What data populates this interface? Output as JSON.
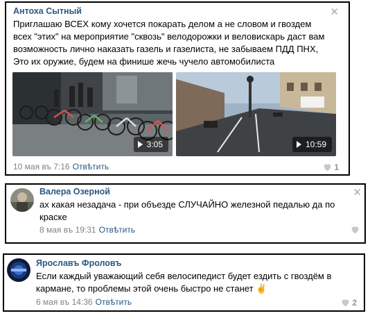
{
  "comments": [
    {
      "author": "Антоха Сытный",
      "text_lines": [
        "Приглашаю ВСЕХ кому хочется покарать делом а не словом и гвоздем",
        "всех \"этих\" на мероприятие \"сквозь\" велодорожки и веловискарь даст вам",
        "возможность лично наказать газель и газелиста, не забываем ПДД ПНХ,",
        "Это их оружие, будем на финише жечь чучело автомобилиста"
      ],
      "videos": [
        {
          "duration": "3:05",
          "icon": "play-icon"
        },
        {
          "duration": "10:59",
          "icon": "play-icon"
        }
      ],
      "date": "10 мая въ 7:16",
      "reply_label": "Отвѣтить",
      "likes": "1",
      "close_glyph": "✕"
    },
    {
      "author": "Валера Озерной",
      "text_lines": [
        "ах какая незадача - при объезде СЛУЧАЙНО железной педалью да по",
        "краске"
      ],
      "date": "8 мая въ 19:31",
      "reply_label": "Отвѣтить",
      "likes": "",
      "close_glyph": "✕"
    },
    {
      "author": "Ярославъ Фроловъ",
      "text_lines": [
        "Если каждый уважающий себя велосипедист будет ездить с гвоздём в",
        "кармане, то проблемы этой очень быстро не станет ✌"
      ],
      "date": "6 мая въ 14:36",
      "reply_label": "Отвѣтить",
      "likes": "2"
    }
  ],
  "colors": {
    "author": "#2a5885",
    "meta": "#828282",
    "like": "#939393"
  }
}
